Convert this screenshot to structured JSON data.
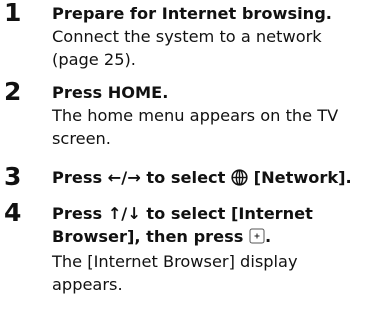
{
  "steps": [
    {
      "number": "1",
      "heading": "Prepare for Internet browsing.",
      "body_lines": [
        "Connect the system to a network",
        "(page 25)."
      ]
    },
    {
      "number": "2",
      "heading": "Press HOME.",
      "body_lines": [
        "The home menu appears on the TV",
        "screen."
      ]
    },
    {
      "number": "3",
      "heading_prefix": "Press ",
      "heading_arrows": "←/→",
      "heading_middle": " to select ",
      "heading_icon": "globe-icon",
      "heading_suffix": " [Network]."
    },
    {
      "number": "4",
      "heading_line1": "Press ↑/↓ to select [Internet",
      "heading_line2_prefix": "Browser], then press ",
      "heading_line2_icon": "enter-button-icon",
      "heading_line2_suffix": ".",
      "body_lines": [
        "The [Internet Browser] display",
        "appears."
      ]
    }
  ]
}
